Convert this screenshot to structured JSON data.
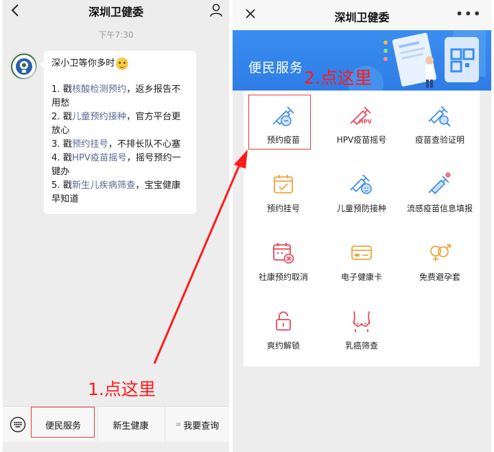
{
  "left_chat": {
    "title": "深圳卫健委",
    "time": "下午7:30",
    "greeting": "深小卫等你多时",
    "items": [
      {
        "num": "1. 戳",
        "link": "核酸检测预约",
        "rest": "，返乡报告不用愁"
      },
      {
        "num": "2. 戳",
        "link": "儿童预约接种",
        "rest": "，官方平台更放心"
      },
      {
        "num": "3. 戳",
        "link": "预约挂号",
        "rest": "，不排长队不心塞"
      },
      {
        "num": "4. 戳",
        "link": "HPV疫苗摇号",
        "rest": "，摇号预约一键办"
      },
      {
        "num": "5. 戳",
        "link": "新生儿疾病筛查",
        "rest": "，宝宝健康早知道"
      }
    ],
    "menu": [
      "便民服务",
      "新生健康",
      "我要查询"
    ],
    "annotation": "1.点这里"
  },
  "right_page": {
    "title": "深圳卫健委",
    "banner_title": "便民服务",
    "annotation": "2.点这里",
    "services": [
      {
        "label": "预约疫苗",
        "icon": "vaccine-icon"
      },
      {
        "label": "HPV疫苗摇号",
        "icon": "hpv-syringe-icon"
      },
      {
        "label": "疫苗查验证明",
        "icon": "vaccine-search-icon"
      },
      {
        "label": "预约挂号",
        "icon": "calendar-check-icon"
      },
      {
        "label": "儿童预防接种",
        "icon": "child-vaccine-icon"
      },
      {
        "label": "流感疫苗信息填报",
        "icon": "flu-vaccine-icon"
      },
      {
        "label": "社康预约取消",
        "icon": "calendar-cancel-icon"
      },
      {
        "label": "电子健康卡",
        "icon": "health-card-icon"
      },
      {
        "label": "免费避孕套",
        "icon": "gender-symbol-icon"
      },
      {
        "label": "爽约解锁",
        "icon": "unlock-icon"
      },
      {
        "label": "乳癌筛查",
        "icon": "breast-screening-icon"
      }
    ]
  },
  "colors": {
    "accent_blue": "#3a8df0",
    "link": "#576b95",
    "annotation_red": "#ff1a1a",
    "icon_blue": "#3d8be8",
    "icon_orange": "#f0a43b",
    "icon_red": "#e8455a"
  }
}
